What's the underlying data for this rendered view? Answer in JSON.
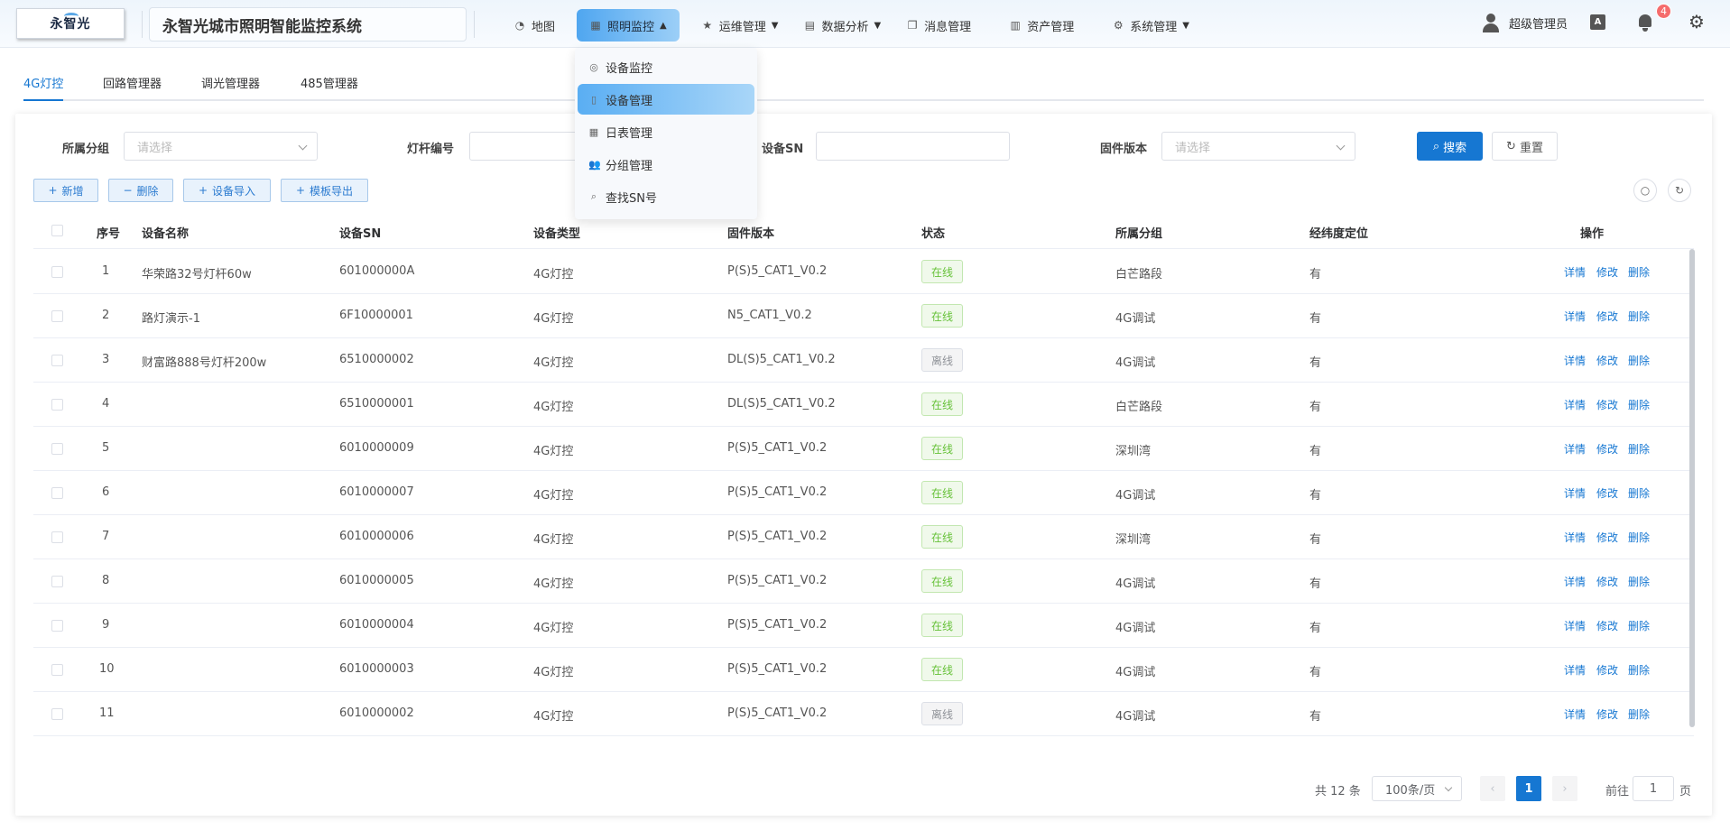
{
  "header": {
    "logo_text": "永智光",
    "system_title": "永智光城市照明智能监控系统",
    "nav": [
      {
        "label": "地图",
        "icon": "dashboard-icon"
      },
      {
        "label": "照明监控",
        "icon": "lightbulb-icon"
      },
      {
        "label": "运维管理",
        "icon": "star-icon"
      },
      {
        "label": "数据分析",
        "icon": "chart-icon"
      },
      {
        "label": "消息管理",
        "icon": "copy-icon"
      },
      {
        "label": "资产管理",
        "icon": "table-icon"
      },
      {
        "label": "系统管理",
        "icon": "gear-icon"
      }
    ],
    "user_name": "超级管理员",
    "lang_label": "A",
    "notification_count": "4"
  },
  "dropdown": {
    "items": [
      {
        "label": "设备监控",
        "icon": "monitor-icon"
      },
      {
        "label": "设备管理",
        "icon": "device-icon"
      },
      {
        "label": "日表管理",
        "icon": "calendar-icon"
      },
      {
        "label": "分组管理",
        "icon": "group-icon"
      },
      {
        "label": "查找SN号",
        "icon": "search-icon"
      }
    ]
  },
  "tabs": [
    "4G灯控",
    "回路管理器",
    "调光管理器",
    "485管理器"
  ],
  "filters": {
    "group_label": "所属分组",
    "group_placeholder": "请选择",
    "pole_label": "灯杆编号",
    "pole_value": "",
    "sn_label": "设备SN",
    "sn_value": "",
    "firmware_label": "固件版本",
    "firmware_placeholder": "请选择",
    "search_label": "搜索",
    "reset_label": "重置"
  },
  "toolbar": {
    "add": "新增",
    "delete": "删除",
    "import": "设备导入",
    "export": "模板导出"
  },
  "table": {
    "columns": [
      "序号",
      "设备名称",
      "设备SN",
      "设备类型",
      "固件版本",
      "状态",
      "所属分组",
      "经纬度定位",
      "操作"
    ],
    "actions": [
      "详情",
      "修改",
      "删除"
    ],
    "rows": [
      {
        "no": "1",
        "name": "华荣路32号灯杆60w",
        "sn": "601000000A",
        "type": "4G灯控",
        "fw": "P(S)5_CAT1_V0.2",
        "status": "在线",
        "group": "白芒路段",
        "geo": "有"
      },
      {
        "no": "2",
        "name": "路灯演示-1",
        "sn": "6F10000001",
        "type": "4G灯控",
        "fw": "N5_CAT1_V0.2",
        "status": "在线",
        "group": "4G调试",
        "geo": "有"
      },
      {
        "no": "3",
        "name": "财富路888号灯杆200w",
        "sn": "6510000002",
        "type": "4G灯控",
        "fw": "DL(S)5_CAT1_V0.2",
        "status": "离线",
        "group": "4G调试",
        "geo": "有"
      },
      {
        "no": "4",
        "name": "",
        "sn": "6510000001",
        "type": "4G灯控",
        "fw": "DL(S)5_CAT1_V0.2",
        "status": "在线",
        "group": "白芒路段",
        "geo": "有"
      },
      {
        "no": "5",
        "name": "",
        "sn": "6010000009",
        "type": "4G灯控",
        "fw": "P(S)5_CAT1_V0.2",
        "status": "在线",
        "group": "深圳湾",
        "geo": "有"
      },
      {
        "no": "6",
        "name": "",
        "sn": "6010000007",
        "type": "4G灯控",
        "fw": "P(S)5_CAT1_V0.2",
        "status": "在线",
        "group": "4G调试",
        "geo": "有"
      },
      {
        "no": "7",
        "name": "",
        "sn": "6010000006",
        "type": "4G灯控",
        "fw": "P(S)5_CAT1_V0.2",
        "status": "在线",
        "group": "深圳湾",
        "geo": "有"
      },
      {
        "no": "8",
        "name": "",
        "sn": "6010000005",
        "type": "4G灯控",
        "fw": "P(S)5_CAT1_V0.2",
        "status": "在线",
        "group": "4G调试",
        "geo": "有"
      },
      {
        "no": "9",
        "name": "",
        "sn": "6010000004",
        "type": "4G灯控",
        "fw": "P(S)5_CAT1_V0.2",
        "status": "在线",
        "group": "4G调试",
        "geo": "有"
      },
      {
        "no": "10",
        "name": "",
        "sn": "6010000003",
        "type": "4G灯控",
        "fw": "P(S)5_CAT1_V0.2",
        "status": "在线",
        "group": "4G调试",
        "geo": "有"
      },
      {
        "no": "11",
        "name": "",
        "sn": "6010000002",
        "type": "4G灯控",
        "fw": "P(S)5_CAT1_V0.2",
        "status": "离线",
        "group": "4G调试",
        "geo": "有"
      }
    ]
  },
  "pagination": {
    "total": "共 12 条",
    "page_size": "100条/页",
    "current_page": "1",
    "goto_prefix": "前往",
    "goto_value": "1",
    "goto_suffix": "页"
  },
  "colors": {
    "primary": "#1677d2",
    "online": "#67c23a",
    "offline": "#909399",
    "badge": "#f56c6c"
  }
}
